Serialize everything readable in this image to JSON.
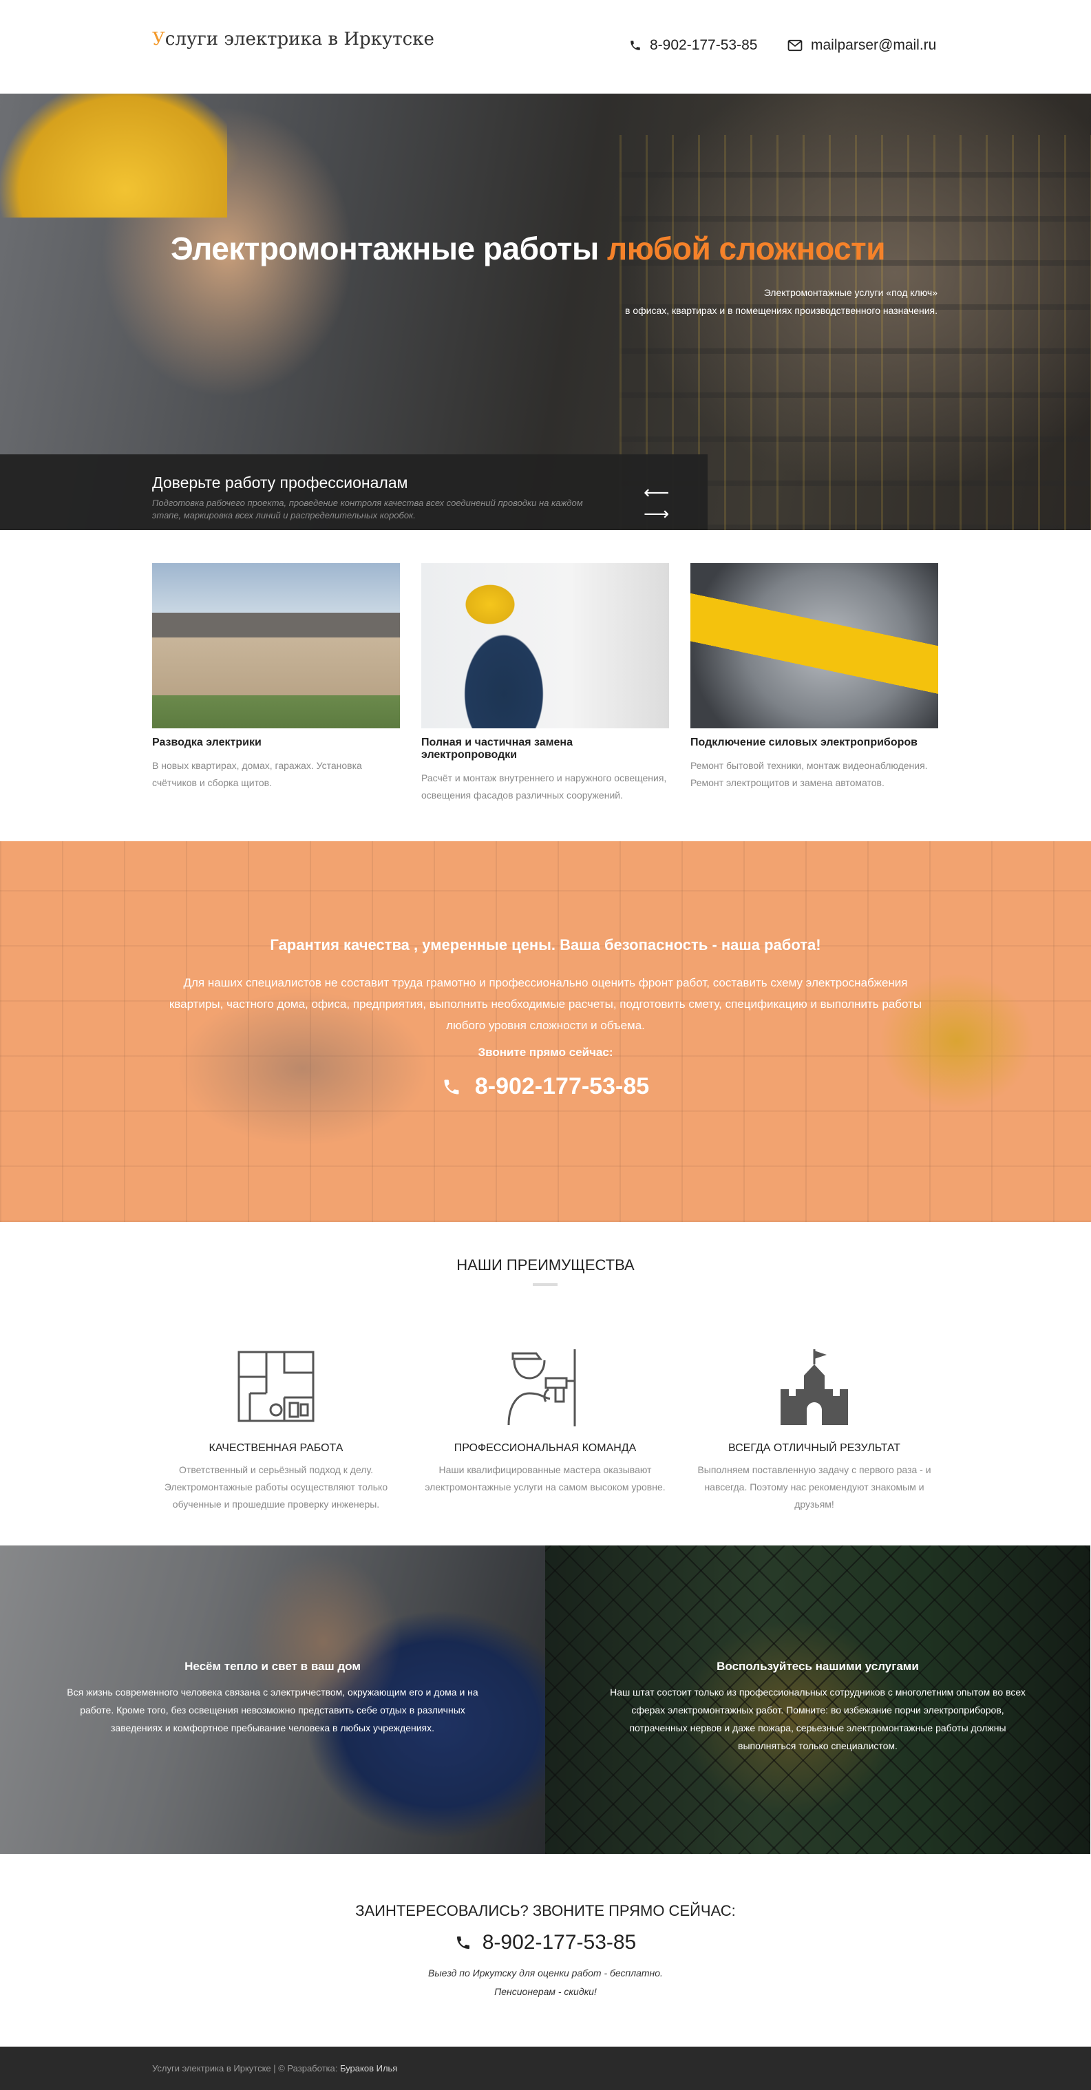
{
  "header": {
    "logo_first_letter": "У",
    "logo_rest": "слуги электрика в Иркутске",
    "phone": "8-902-177-53-85",
    "email": "mailparser@mail.ru",
    "phone_icon": "phone-icon",
    "email_icon": "envelope-icon"
  },
  "hero": {
    "title_white": "Электромонтажные работы ",
    "title_accent": "любой сложности",
    "subtitle_line1": "Электромонтажные услуги «под ключ»",
    "subtitle_line2": "в офисах, квартирах и в помещениях производственного назначения.",
    "caption_title": "Доверьте работу профессионалам",
    "caption_text": "Подготовка рабочего проекта, проведение контроля качества всех соединений проводки на каждом этапе, маркировка всех линий и распределительных коробок.",
    "prev_arrow": "⟵",
    "next_arrow": "⟶"
  },
  "services": [
    {
      "title": "Разводка электрики",
      "text": "В новых квартирах, домах, гаражах. Установка счётчиков и сборка щитов."
    },
    {
      "title": "Полная и частичная замена электропроводки",
      "text": "Расчёт и монтаж внутреннего и наружного освещения, освещения фасадов различных сооружений."
    },
    {
      "title": "Подключение силовых электроприборов",
      "text": "Ремонт бытовой техники, монтаж видеонаблюдения. Ремонт электрощитов и замена автоматов."
    }
  ],
  "guarantee": {
    "title": "Гарантия качества , умеренные цены. Ваша безопасность - наша работа!",
    "text": "Для наших специалистов не составит труда грамотно и профессионально оценить фронт работ, составить схему электроснабжения квартиры, частного дома, офиса, предприятия, выполнить необходимые расчеты, подготовить смету, спецификацию и выполнить работы любого уровня сложности и объема.",
    "call_label": "Звоните прямо сейчас:",
    "phone": "8-902-177-53-85"
  },
  "advantages": {
    "title": "НАШИ ПРЕИМУЩЕСТВА",
    "items": [
      {
        "icon": "floor-plan-icon",
        "title": "КАЧЕСТВЕННАЯ РАБОТА",
        "text": "Ответственный и серьёзный подход к делу. Электромонтажные работы осуществляют только обученные и прошедшие проверку инженеры."
      },
      {
        "icon": "worker-drill-icon",
        "title": "ПРОФЕССИОНАЛЬНАЯ КОМАНДА",
        "text": "Наши квалифицированные мастера оказывают электромонтажные услуги на самом высоком уровне."
      },
      {
        "icon": "castle-icon",
        "title": "ВСЕГДА ОТЛИЧНЫЙ РЕЗУЛЬТАТ",
        "text": "Выполняем поставленную задачу с первого раза - и навсегда. Поэтому нас рекомендуют знакомым и друзьям!"
      }
    ]
  },
  "panels": [
    {
      "title": "Несём тепло и свет в ваш дом",
      "text": "Вся жизнь современного человека связана с электричеством, окружающим его и дома и на работе. Кроме того, без освещения невозможно представить себе отдых в различных заведениях и комфортное пребывание человека в любых учреждениях."
    },
    {
      "title": "Воспользуйтесь нашими услугами",
      "text": "Наш штат состоит только из профессиональных сотрудников с многолетним опытом во всех сферах электромонтажных работ. Помните: во избежание порчи электроприборов, потраченных нервов и даже пожара, серьезные электромонтажные работы должны выполняться только специалистом."
    }
  ],
  "call": {
    "title": "ЗАИНТЕРЕСОВАЛИСЬ? ЗВОНИТЕ ПРЯМО СЕЙЧАС:",
    "phone": "8-902-177-53-85",
    "note_line1": "Выезд по Иркутску для оценки работ - бесплатно.",
    "note_line2": "Пенсионерам - скидки!"
  },
  "footer": {
    "text": "Услуги электрика в Иркутске | © Разработка: ",
    "author": "Бураков Илья"
  },
  "colors": {
    "accent": "#f5822a",
    "guarantee_bg": "#f2a370",
    "footer_bg": "#2a2a2a",
    "caption_bg": "#222222"
  }
}
